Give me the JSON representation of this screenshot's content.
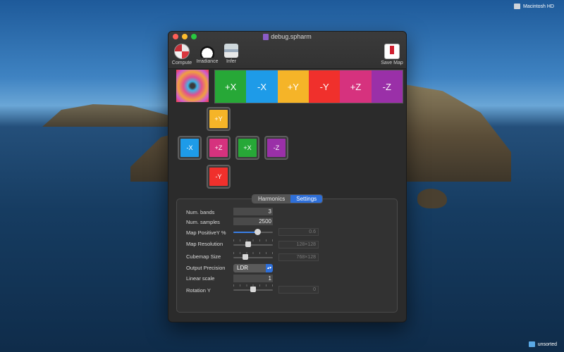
{
  "desktop": {
    "hd_label": "Macintosh HD",
    "folder_label": "unsorted"
  },
  "window": {
    "title": "debug.spharm",
    "toolbar": {
      "compute": "Compute",
      "irradiance": "Irradiance",
      "infer": "Infer",
      "save_map": "Save Map"
    }
  },
  "faces_strip": [
    {
      "label": "+X",
      "color": "#27a837"
    },
    {
      "label": "-X",
      "color": "#1e9be8"
    },
    {
      "label": "+Y",
      "color": "#f5b428"
    },
    {
      "label": "-Y",
      "color": "#f0302c"
    },
    {
      "label": "+Z",
      "color": "#d6327e"
    },
    {
      "label": "-Z",
      "color": "#9a30a8"
    }
  ],
  "cross": {
    "py": "+Y",
    "nx": "-X",
    "pz": "+Z",
    "px": "+X",
    "nz": "-Z",
    "ny": "-Y"
  },
  "tabs": {
    "harmonics": "Harmonics",
    "settings": "Settings",
    "active": "Settings"
  },
  "settings": {
    "num_bands": {
      "label": "Num. bands",
      "value": "3"
    },
    "num_samples": {
      "label": "Num. samples",
      "value": "2500"
    },
    "map_positive_y": {
      "label": "Map PositiveY %",
      "value": "0.6",
      "level": 0.6
    },
    "map_resolution": {
      "label": "Map Resolution",
      "value": "128×128",
      "level": 0.38
    },
    "cubemap_size": {
      "label": "Cubemap Size",
      "value": "768×128",
      "level": 0.3
    },
    "output_precision": {
      "label": "Output Precision",
      "value": "LDR"
    },
    "linear_scale": {
      "label": "Linear scale",
      "value": "1"
    },
    "rotation_y": {
      "label": "Rotation Y",
      "value": "0",
      "level": 0.5
    }
  }
}
